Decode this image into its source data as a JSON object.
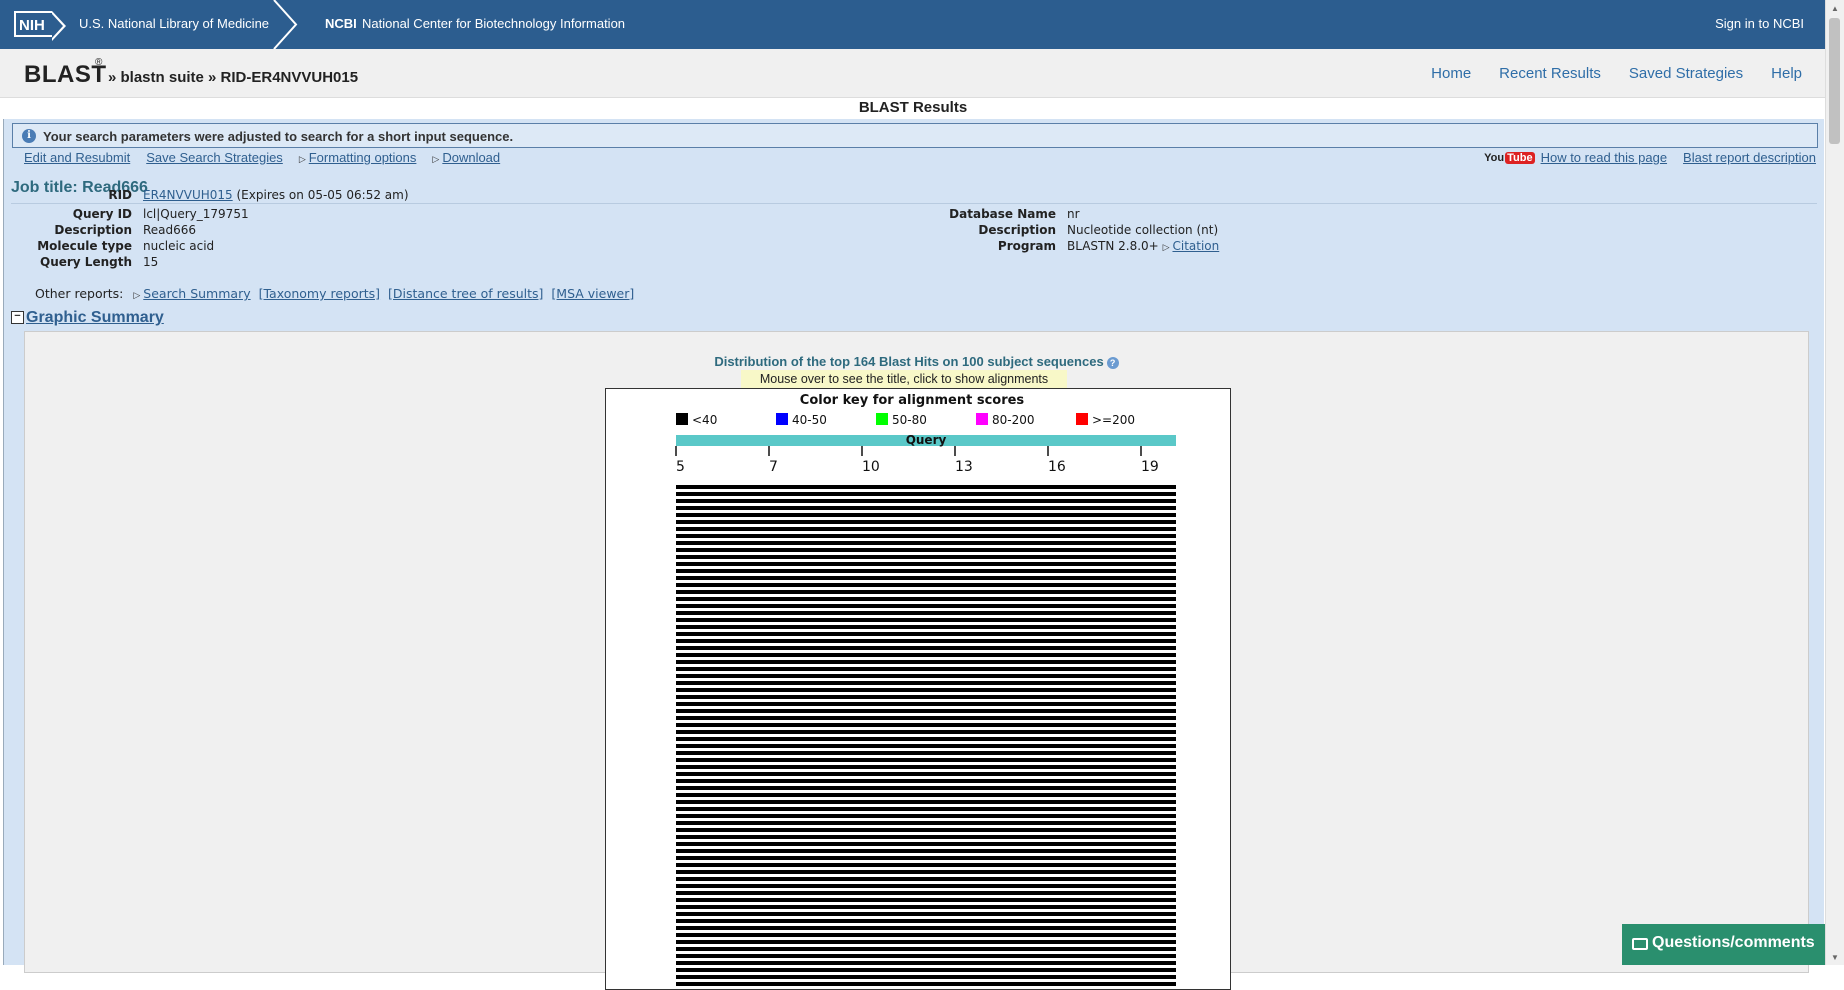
{
  "topbar": {
    "nih_logo": "NIH",
    "nlm": "U.S. National Library of Medicine",
    "ncbi_abbr": "NCBI",
    "ncbi_full": "National Center for Biotechnology Information",
    "signin": "Sign in to NCBI"
  },
  "header": {
    "logo": "BLAST",
    "reg": "®",
    "breadcrumb": "» blastn suite » RID-ER4NVVUH015",
    "nav": [
      "Home",
      "Recent Results",
      "Saved Strategies",
      "Help"
    ]
  },
  "page_title": "BLAST Results",
  "notice": "Your search parameters were adjusted to search for a short input sequence.",
  "actions": {
    "edit": "Edit and Resubmit",
    "save": "Save Search Strategies",
    "formatting": "Formatting options",
    "download": "Download"
  },
  "right_links": {
    "youtube_you": "You",
    "youtube_tube": "Tube",
    "howto": "How to read this page",
    "report": "Blast report description"
  },
  "job_title": "Job title: Read666",
  "query_info": {
    "rid_label": "RID",
    "rid": "ER4NVVUH015",
    "rid_expiry": "(Expires on 05-05 06:52 am)",
    "query_id_label": "Query ID",
    "query_id": "lcl|Query_179751",
    "description_label": "Description",
    "description": "Read666",
    "molecule_label": "Molecule type",
    "molecule": "nucleic acid",
    "length_label": "Query Length",
    "length": "15"
  },
  "db_info": {
    "dbname_label": "Database Name",
    "dbname": "nr",
    "description_label": "Description",
    "description": "Nucleotide collection (nt)",
    "program_label": "Program",
    "program": "BLASTN 2.8.0+",
    "citation": "Citation"
  },
  "other_reports": {
    "label": "Other reports:",
    "search_summary": "Search Summary",
    "taxonomy": "[Taxonomy reports]",
    "distance": "[Distance tree of results]",
    "msa": "[MSA viewer]"
  },
  "graphic_summary": {
    "heading": "Graphic Summary",
    "dist_title": "Distribution of the top 164 Blast Hits on 100 subject sequences",
    "mouseover": "Mouse over to see the title, click to show alignments",
    "color_key_title": "Color key for alignment scores",
    "color_key": [
      {
        "label": "<40",
        "color": "#000000"
      },
      {
        "label": "40-50",
        "color": "#0000ff"
      },
      {
        "label": "50-80",
        "color": "#00ff00"
      },
      {
        "label": "80-200",
        "color": "#ff00ff"
      },
      {
        "label": ">=200",
        "color": "#ff0000"
      }
    ],
    "query_label": "Query",
    "query_bar_color": "#5ac8c8",
    "ticks": [
      "5",
      "7",
      "10",
      "13",
      "16",
      "19"
    ],
    "hit_color": "#000000"
  },
  "feedback": "Questions/comments"
}
